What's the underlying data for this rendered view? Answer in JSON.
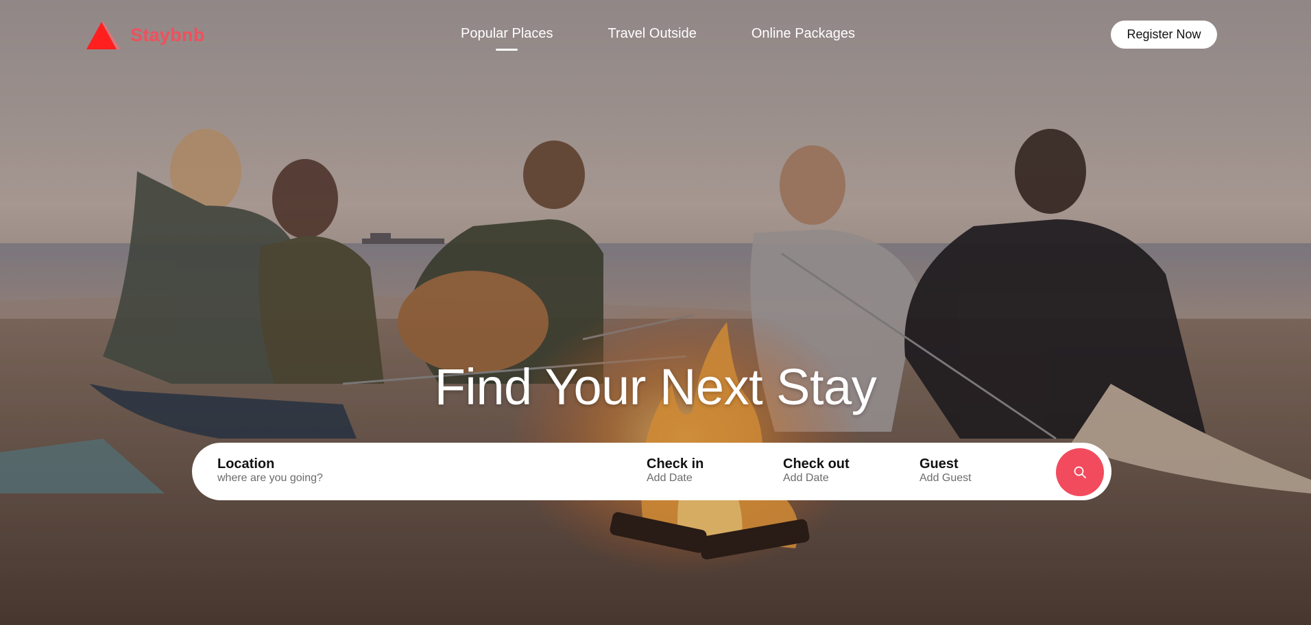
{
  "brand": {
    "name": "Staybnb",
    "accent": "#f0505d"
  },
  "nav": {
    "items": [
      {
        "label": "Popular Places",
        "active": true
      },
      {
        "label": "Travel Outside",
        "active": false
      },
      {
        "label": "Online Packages",
        "active": false
      }
    ]
  },
  "header": {
    "register_label": "Register Now"
  },
  "hero": {
    "title": "Find Your Next Stay",
    "background": "beach-campfire-photo"
  },
  "search": {
    "location": {
      "label": "Location",
      "placeholder": "where are you going?"
    },
    "check_in": {
      "label": "Check in",
      "value": "Add Date"
    },
    "check_out": {
      "label": "Check out",
      "value": "Add Date"
    },
    "guest": {
      "label": "Guest",
      "value": "Add Guest"
    },
    "button_icon": "search-icon",
    "button_color": "#f24b5e"
  }
}
